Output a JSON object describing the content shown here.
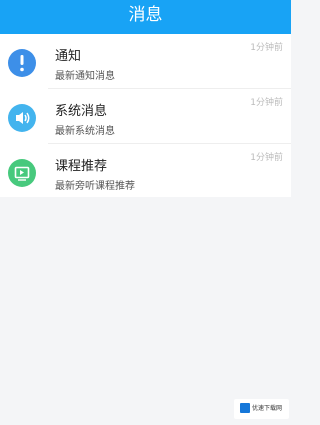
{
  "header": {
    "title": "消息"
  },
  "messages": [
    {
      "title": "通知",
      "subtitle": "最新通知消息",
      "time": "1分钟前",
      "icon": "info-icon",
      "color": "#3d8fe8"
    },
    {
      "title": "系统消息",
      "subtitle": "最新系统消息",
      "time": "1分钟前",
      "icon": "speaker-icon",
      "color": "#43b4ee"
    },
    {
      "title": "课程推荐",
      "subtitle": "最新旁听课程推荐",
      "time": "1分钟前",
      "icon": "video-play-icon",
      "color": "#47c97d"
    }
  ],
  "watermark": {
    "text": "优速下载网"
  }
}
